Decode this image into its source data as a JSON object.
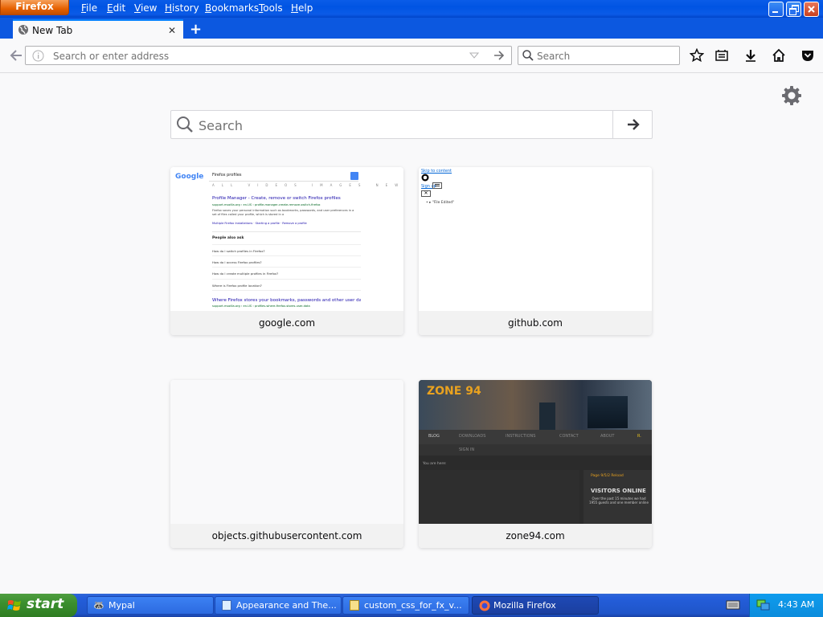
{
  "window": {
    "app_button": "Firefox",
    "menu": [
      "File",
      "Edit",
      "View",
      "History",
      "Bookmarks",
      "Tools",
      "Help"
    ]
  },
  "tabs": [
    {
      "title": "New Tab"
    }
  ],
  "navbar": {
    "url_placeholder": "Search or enter address",
    "search_placeholder": "Search"
  },
  "newtab": {
    "search_placeholder": "Search",
    "tiles": [
      {
        "label": "google.com"
      },
      {
        "label": "github.com"
      },
      {
        "label": "objects.githubusercontent.com"
      },
      {
        "label": "zone94.com"
      }
    ]
  },
  "thumbs": {
    "google": {
      "logo": "Google",
      "query": "Firefox profiles",
      "tabs": [
        "ALL",
        "VIDEOS",
        "IMAGES",
        "SHOPPING",
        "NEWS",
        "MORE"
      ],
      "result1_title": "Profile Manager - Create, remove or switch Firefox profiles",
      "result1_url": "support.mozilla.org › en-US › profile-manager-create-remove-switch-firefox",
      "result1_desc": "Firefox saves your personal information such as bookmarks, passwords, and user preferences in a set of files called your profile, which is stored in a",
      "result1_links": "Multiple Firefox Installations · Starting a profile · Remove a profile",
      "paa_title": "People also ask",
      "paa": [
        "How do I switch profiles in Firefox?",
        "How do I access Firefox profiles?",
        "How do I create multiple profiles in Firefox?",
        "Where is Firefox profile location?"
      ],
      "result2_title": "Where Firefox stores your bookmarks, passwords and other user data",
      "result2_url": "support.mozilla.org › en-US › profiles-where-firefox-stores-user-data"
    },
    "github": {
      "skip": "Skip to content",
      "signup": "Sign up",
      "item": "\"File Edited\""
    },
    "zone94": {
      "logo": "ZONE 94",
      "nav": [
        "BLOG",
        "DOWNLOADS",
        "INSTRUCTIONS",
        "CONTACT",
        "ABOUT",
        "SIGN IN"
      ],
      "breadcrumb": "You are here:",
      "sidebar_title": "Page 9/5/2 Reload",
      "visitors": "VISITORS ONLINE",
      "visitors_text": "Over the past 15 minutes we had 1955 guests and one member online"
    }
  },
  "taskbar": {
    "start": "start",
    "tasks": [
      "Mypal",
      "Appearance and The...",
      "custom_css_for_fx_v...",
      "Mozilla Firefox"
    ],
    "clock": "4:43 AM"
  },
  "colors": {
    "accent": "#0a84ff",
    "xp_blue": "#0054e3",
    "start_green": "#3b8f2e"
  }
}
